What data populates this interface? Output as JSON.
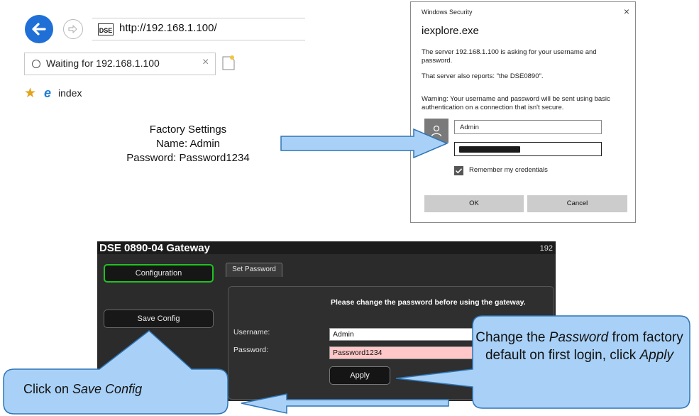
{
  "browser": {
    "url": "http://192.168.1.100/",
    "tab_label": "Waiting for 192.168.1.100",
    "tab_close": "×",
    "favorite": "index",
    "site_icon_text": "DSE"
  },
  "factory_note": {
    "line1": "Factory Settings",
    "line2": "Name: Admin",
    "line3": "Password: Password1234"
  },
  "dialog": {
    "window_title": "Windows Security",
    "close": "×",
    "app_name": "iexplore.exe",
    "message": "The server 192.168.1.100 is asking for your username and password.",
    "server_report": "That server also reports: \"the DSE0890\".",
    "warning": "Warning: Your username and password will be sent using basic authentication on a connection that isn't secure.",
    "username_value": "Admin",
    "remember_label": "Remember my credentials",
    "ok_label": "OK",
    "cancel_label": "Cancel"
  },
  "gateway": {
    "title": "DSE 0890-04 Gateway",
    "ip_fragment": "192",
    "configuration_button": "Configuration",
    "save_config_button": "Save Config",
    "tab_label": "Set Password",
    "message": "Please change the password before using the gateway.",
    "username_label": "Username:",
    "username_value": "Admin",
    "password_label": "Password:",
    "password_value": "Password1234",
    "apply_button": "Apply"
  },
  "callouts": {
    "left": {
      "prefix": "Click on ",
      "emphasis": "Save Config"
    },
    "right": {
      "prefix": "Change the ",
      "emphasis": "Password",
      "middle": " from factory default on first login, click ",
      "emphasis2": "Apply"
    }
  },
  "colors": {
    "callout_fill": "#a9d1f7",
    "callout_stroke": "#2e75b6",
    "gateway_bg": "#2b2b2b",
    "active_green": "#1fc21f",
    "password_field": "#ffc7c7",
    "browser_blue": "#1f6fd6"
  }
}
